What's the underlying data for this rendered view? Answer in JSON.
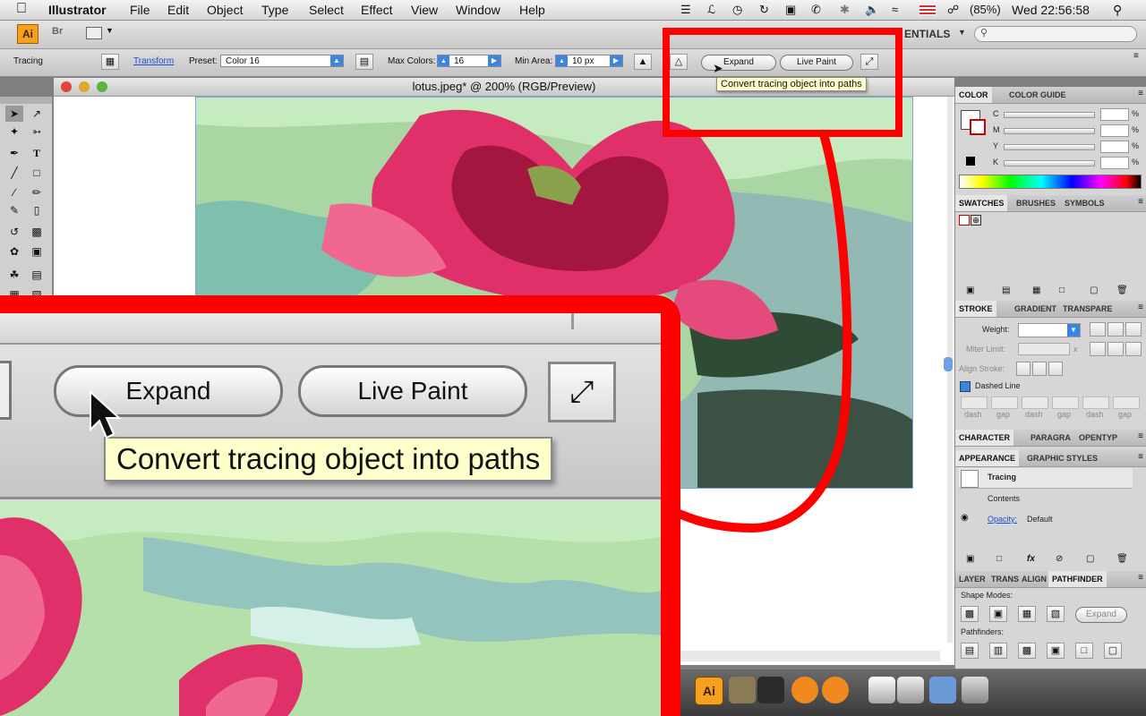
{
  "menubar": {
    "app_name": "Illustrator",
    "items": [
      "File",
      "Edit",
      "Object",
      "Type",
      "Select",
      "Effect",
      "View",
      "Window",
      "Help"
    ],
    "battery": "(85%)",
    "clock": "Wed 22:56:58"
  },
  "appbar": {
    "ai_logo": "Ai",
    "bridge_label": "Br",
    "workspace": "ENTIALS"
  },
  "control": {
    "tracing_label": "Tracing",
    "transform_link": "Transform",
    "preset_label": "Preset:",
    "preset_value": "Color 16",
    "max_colors_label": "Max Colors:",
    "max_colors_value": "16",
    "min_area_label": "Min Area:",
    "min_area_value": "10 px",
    "expand_label": "Expand",
    "live_paint_label": "Live Paint",
    "tooltip": "Convert tracing object into paths"
  },
  "document": {
    "title": "lotus.jpeg* @ 200% (RGB/Preview)"
  },
  "color_panel": {
    "tabs": [
      "COLOR",
      "COLOR GUIDE"
    ],
    "channels": [
      "C",
      "M",
      "Y",
      "K"
    ],
    "unit": "%"
  },
  "swatches_panel": {
    "tabs": [
      "SWATCHES",
      "BRUSHES",
      "SYMBOLS"
    ]
  },
  "stroke_panel": {
    "tabs": [
      "STROKE",
      "GRADIENT",
      "TRANSPARE"
    ],
    "weight_label": "Weight:",
    "miter_label": "Miter Limit:",
    "miter_x": "x",
    "align_label": "Align Stroke:",
    "dashed_label": "Dashed Line",
    "dash_labels": [
      "dash",
      "gap",
      "dash",
      "gap",
      "dash",
      "gap"
    ]
  },
  "character_panel": {
    "tabs": [
      "CHARACTER",
      "PARAGRA",
      "OPENTYP"
    ]
  },
  "appearance_panel": {
    "tabs": [
      "APPEARANCE",
      "GRAPHIC STYLES"
    ],
    "object": "Tracing",
    "contents": "Contents",
    "opacity_label": "Opacity:",
    "opacity_value": "Default"
  },
  "pathfinder_panel": {
    "tabs": [
      "LAYER",
      "TRANS",
      "ALIGN",
      "PATHFINDER"
    ],
    "shape_modes": "Shape Modes:",
    "expand": "Expand",
    "pathfinders": "Pathfinders:"
  },
  "zoom_callout": {
    "expand_label": "Expand",
    "live_paint_label": "Live Paint",
    "tooltip": "Convert tracing object into paths"
  },
  "colors": {
    "highlight_red": "#ff0000",
    "lotus_pink": "#e0306a",
    "leaf_green": "#b5e0a9",
    "water_teal": "#93c4bd"
  }
}
